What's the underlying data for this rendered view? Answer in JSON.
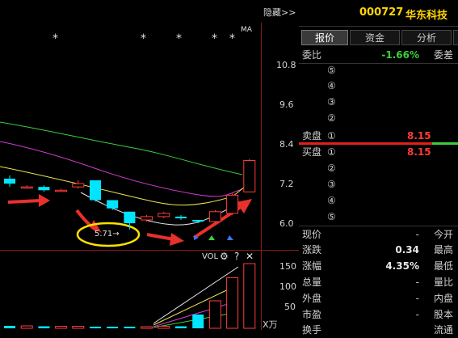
{
  "header": {
    "hide_label": "隐藏>>",
    "stock_code": "000727",
    "stock_name": "华东科技"
  },
  "tabs": [
    "报价",
    "资金",
    "分析"
  ],
  "chart": {
    "ma_label": "MA",
    "vol_label": "VOL",
    "vol_unit": "X万",
    "star_glyph": "*",
    "price_ticks": [
      "10.8",
      "9.6",
      "8.4",
      "7.2",
      "6.0"
    ],
    "vol_ticks": [
      "150",
      "100",
      "50"
    ],
    "low_annotation": "5.71→",
    "gear_glyph": "⚙",
    "help_glyph": "?",
    "close_glyph": "✕"
  },
  "chart_data": {
    "type": "candlestick",
    "price_axis": [
      6.0,
      7.2,
      8.4,
      9.6,
      10.8
    ],
    "volume_axis": [
      50,
      100,
      150
    ],
    "annotated_low": 5.71,
    "candles": [
      {
        "open": 7.25,
        "close": 7.1,
        "high": 7.35,
        "low": 7.0
      },
      {
        "open": 7.0,
        "close": 7.0,
        "high": 7.05,
        "low": 6.95
      },
      {
        "open": 7.0,
        "close": 6.9,
        "high": 7.05,
        "low": 6.85
      },
      {
        "open": 6.9,
        "close": 6.9,
        "high": 6.95,
        "low": 6.85
      },
      {
        "open": 7.0,
        "close": 7.1,
        "high": 7.2,
        "low": 6.95
      },
      {
        "open": 7.2,
        "close": 6.6,
        "high": 7.2,
        "low": 6.55
      },
      {
        "open": 6.6,
        "close": 6.35,
        "high": 6.6,
        "low": 6.3
      },
      {
        "open": 6.25,
        "close": 5.9,
        "high": 6.25,
        "low": 5.71
      },
      {
        "open": 6.0,
        "close": 6.1,
        "high": 6.15,
        "low": 5.95
      },
      {
        "open": 6.1,
        "close": 6.2,
        "high": 6.25,
        "low": 6.05
      },
      {
        "open": 6.1,
        "close": 6.05,
        "high": 6.15,
        "low": 6.0
      },
      {
        "open": 6.0,
        "close": 5.95,
        "high": 6.0,
        "low": 5.9
      },
      {
        "open": 5.95,
        "close": 6.25,
        "high": 6.3,
        "low": 5.9
      },
      {
        "open": 6.2,
        "close": 6.75,
        "high": 6.8,
        "low": 6.15
      },
      {
        "open": 6.85,
        "close": 7.8,
        "high": 7.85,
        "low": 6.85
      }
    ],
    "volumes": [
      6,
      6,
      5,
      5,
      5,
      4,
      4,
      4,
      4,
      5,
      5,
      34,
      68,
      125,
      160
    ]
  },
  "quote": {
    "weibi_label": "委比",
    "weibi_value": "-1.66%",
    "weicha_label": "委差",
    "sell_label": "卖盘",
    "buy_label": "买盘",
    "levels": [
      "⑤",
      "④",
      "③",
      "②",
      "①"
    ],
    "buy_levels": [
      "①",
      "②",
      "③",
      "④",
      "⑤"
    ],
    "sell1_price": "8.15",
    "buy1_price": "8.15",
    "rows": [
      {
        "label": "现价",
        "value": "-",
        "label2": "今开"
      },
      {
        "label": "涨跌",
        "value": "0.34",
        "label2": "最高"
      },
      {
        "label": "涨幅",
        "value": "4.35%",
        "label2": "最低"
      },
      {
        "label": "总量",
        "value": "-",
        "label2": "量比"
      },
      {
        "label": "外盘",
        "value": "-",
        "label2": "内盘"
      },
      {
        "label": "市盈",
        "value": "-",
        "label2": "股本"
      },
      {
        "label": "换手",
        "value": "",
        "label2": "流通"
      }
    ],
    "accent_red": "#ff3b3b",
    "accent_green": "#3ccf3c"
  }
}
